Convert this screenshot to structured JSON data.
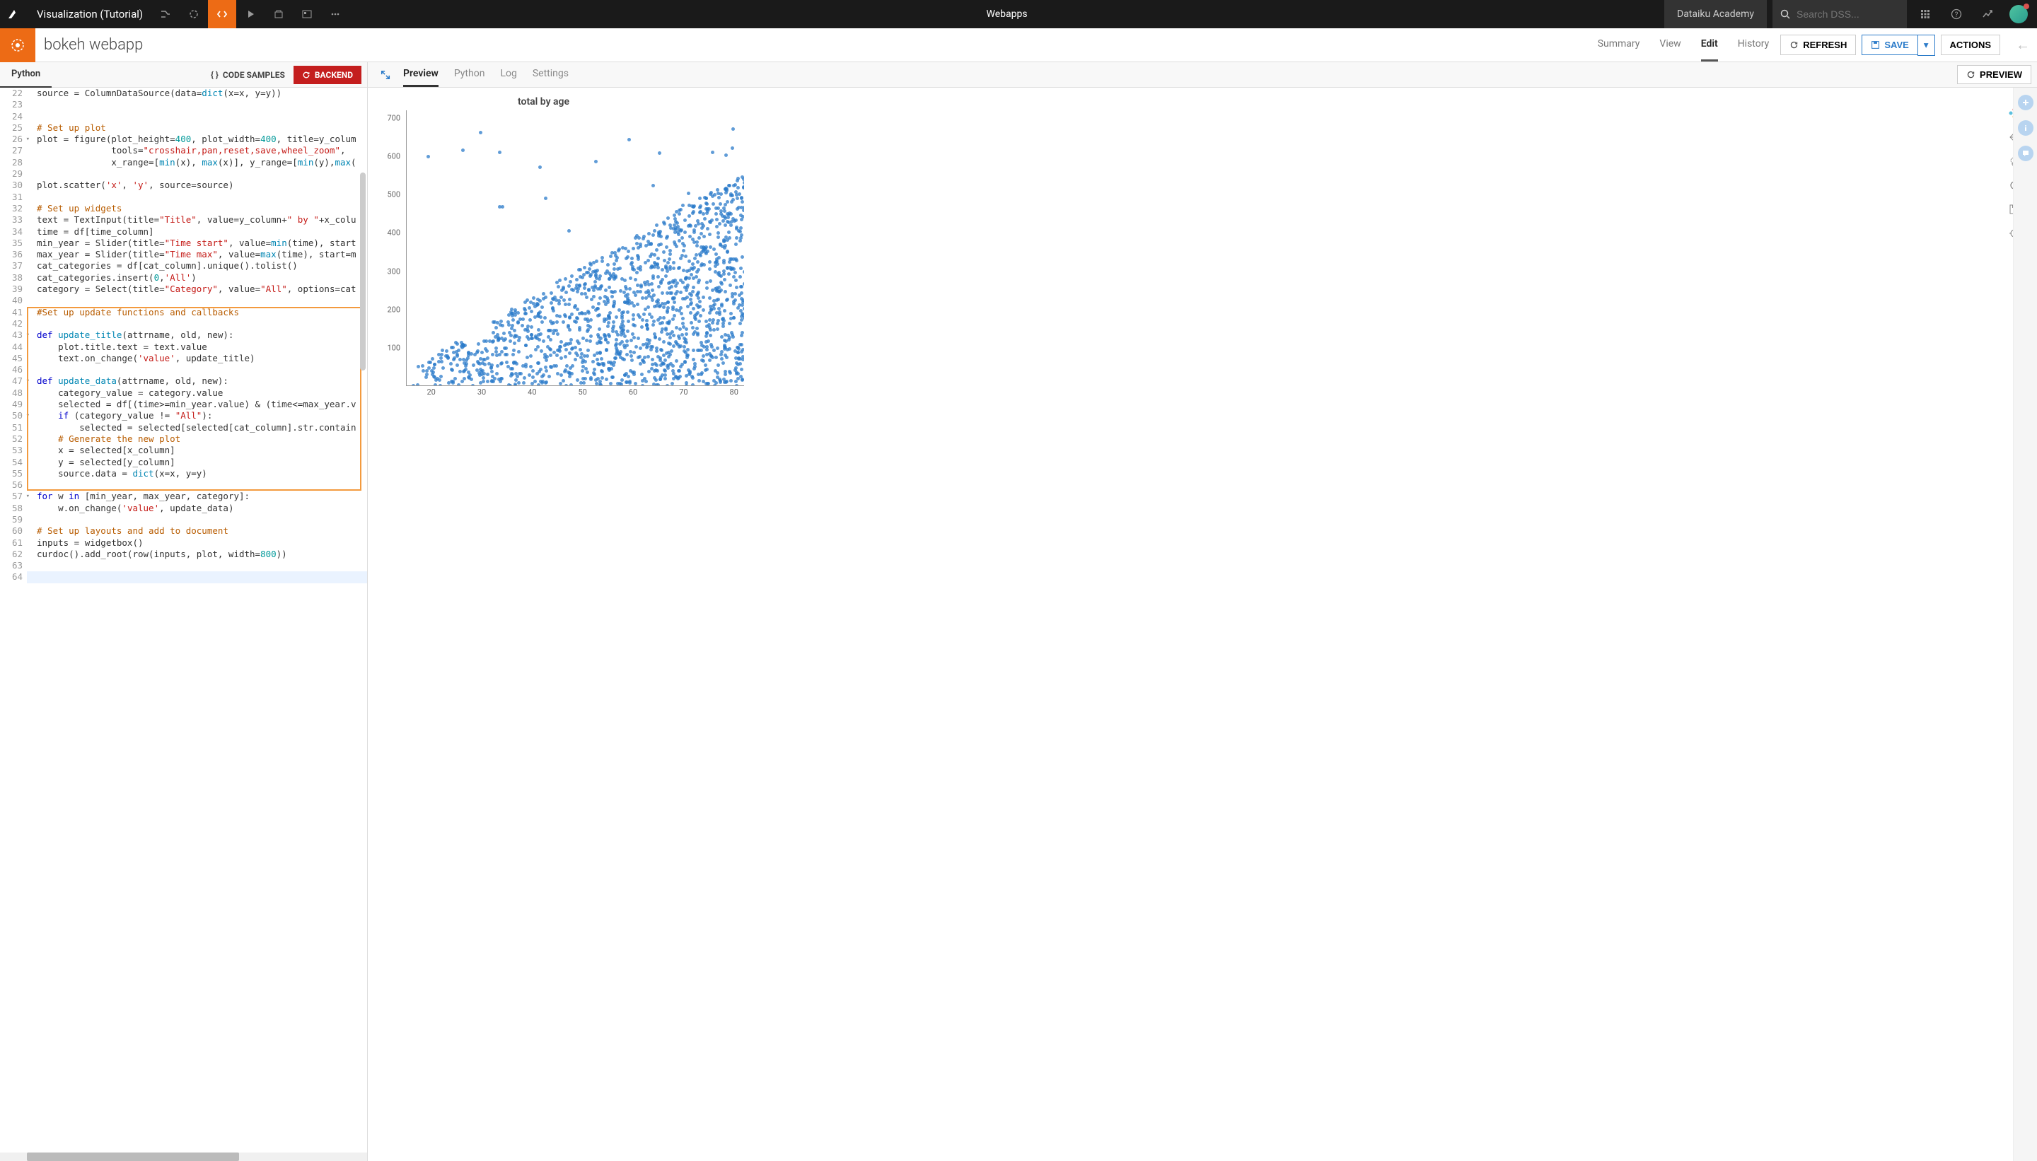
{
  "topbar": {
    "project_title": "Visualization (Tutorial)",
    "center_label": "Webapps",
    "academy": "Dataiku Academy",
    "search_placeholder": "Search DSS..."
  },
  "secondbar": {
    "title": "bokeh webapp",
    "tabs": [
      "Summary",
      "View",
      "Edit",
      "History"
    ],
    "active_tab": 2,
    "refresh": "REFRESH",
    "save": "SAVE",
    "actions": "ACTIONS"
  },
  "thirdbar": {
    "left_tab": "Python",
    "code_samples": "CODE SAMPLES",
    "backend": "BACKEND",
    "preview_tabs": [
      "Preview",
      "Python",
      "Log",
      "Settings"
    ],
    "preview_active": 0,
    "preview_btn": "PREVIEW"
  },
  "editor": {
    "start_line": 22,
    "fold_lines": [
      26,
      43,
      47,
      50,
      57
    ],
    "highlight_start": 41,
    "highlight_end": 56,
    "current_line": 64,
    "lines": [
      [
        [
          "va",
          "source = ColumnDataSource(data="
        ],
        [
          "fn",
          "dict"
        ],
        [
          "va",
          "(x=x, y=y))"
        ]
      ],
      [],
      [],
      [
        [
          "cm",
          "# Set up plot"
        ]
      ],
      [
        [
          "va",
          "plot = figure(plot_height="
        ],
        [
          "nm",
          "400"
        ],
        [
          "va",
          ", plot_width="
        ],
        [
          "nm",
          "400"
        ],
        [
          "va",
          ", title=y_colum"
        ]
      ],
      [
        [
          "va",
          "              tools="
        ],
        [
          "st",
          "\"crosshair,pan,reset,save,wheel_zoom\""
        ],
        [
          "va",
          ","
        ]
      ],
      [
        [
          "va",
          "              x_range=["
        ],
        [
          "fn",
          "min"
        ],
        [
          "va",
          "(x), "
        ],
        [
          "fn",
          "max"
        ],
        [
          "va",
          "(x)], y_range=["
        ],
        [
          "fn",
          "min"
        ],
        [
          "va",
          "(y),"
        ],
        [
          "fn",
          "max"
        ],
        [
          "va",
          "("
        ]
      ],
      [],
      [
        [
          "va",
          "plot.scatter("
        ],
        [
          "st",
          "'x'"
        ],
        [
          "va",
          ", "
        ],
        [
          "st",
          "'y'"
        ],
        [
          "va",
          ", source=source)"
        ]
      ],
      [],
      [
        [
          "cm",
          "# Set up widgets"
        ]
      ],
      [
        [
          "va",
          "text = TextInput(title="
        ],
        [
          "st",
          "\"Title\""
        ],
        [
          "va",
          ", value=y_column+"
        ],
        [
          "st",
          "\" by \""
        ],
        [
          "va",
          "+x_colu"
        ]
      ],
      [
        [
          "va",
          "time = df[time_column]"
        ]
      ],
      [
        [
          "va",
          "min_year = Slider(title="
        ],
        [
          "st",
          "\"Time start\""
        ],
        [
          "va",
          ", value="
        ],
        [
          "fn",
          "min"
        ],
        [
          "va",
          "(time), start"
        ]
      ],
      [
        [
          "va",
          "max_year = Slider(title="
        ],
        [
          "st",
          "\"Time max\""
        ],
        [
          "va",
          ", value="
        ],
        [
          "fn",
          "max"
        ],
        [
          "va",
          "(time), start=m"
        ]
      ],
      [
        [
          "va",
          "cat_categories = df[cat_column].unique().tolist()"
        ]
      ],
      [
        [
          "va",
          "cat_categories.insert("
        ],
        [
          "nm",
          "0"
        ],
        [
          "va",
          ","
        ],
        [
          "st",
          "'All'"
        ],
        [
          "va",
          ")"
        ]
      ],
      [
        [
          "va",
          "category = Select(title="
        ],
        [
          "st",
          "\"Category\""
        ],
        [
          "va",
          ", value="
        ],
        [
          "st",
          "\"All\""
        ],
        [
          "va",
          ", options=cat"
        ]
      ],
      [],
      [
        [
          "cm",
          "#Set up update functions and callbacks"
        ]
      ],
      [],
      [
        [
          "kw",
          "def "
        ],
        [
          "fn",
          "update_title"
        ],
        [
          "va",
          "(attrname, old, new):"
        ]
      ],
      [
        [
          "va",
          "    plot.title.text = text.value"
        ]
      ],
      [
        [
          "va",
          "    text.on_change("
        ],
        [
          "st",
          "'value'"
        ],
        [
          "va",
          ", update_title)"
        ]
      ],
      [],
      [
        [
          "kw",
          "def "
        ],
        [
          "fn",
          "update_data"
        ],
        [
          "va",
          "(attrname, old, new):"
        ]
      ],
      [
        [
          "va",
          "    category_value = category.value"
        ]
      ],
      [
        [
          "va",
          "    selected = df[(time>=min_year.value) & (time<=max_year.v"
        ]
      ],
      [
        [
          "va",
          "    "
        ],
        [
          "kw",
          "if"
        ],
        [
          "va",
          " (category_value != "
        ],
        [
          "st",
          "\"All\""
        ],
        [
          "va",
          "):"
        ]
      ],
      [
        [
          "va",
          "        selected = selected[selected[cat_column].str.contain"
        ]
      ],
      [
        [
          "va",
          "    "
        ],
        [
          "cm",
          "# Generate the new plot"
        ]
      ],
      [
        [
          "va",
          "    x = selected[x_column]"
        ]
      ],
      [
        [
          "va",
          "    y = selected[y_column]"
        ]
      ],
      [
        [
          "va",
          "    source.data = "
        ],
        [
          "fn",
          "dict"
        ],
        [
          "va",
          "(x=x, y=y)"
        ]
      ],
      [],
      [
        [
          "kw",
          "for"
        ],
        [
          "va",
          " w "
        ],
        [
          "kw",
          "in"
        ],
        [
          "va",
          " [min_year, max_year, category]:"
        ]
      ],
      [
        [
          "va",
          "    w.on_change("
        ],
        [
          "st",
          "'value'"
        ],
        [
          "va",
          ", update_data)"
        ]
      ],
      [],
      [
        [
          "cm",
          "# Set up layouts and add to document"
        ]
      ],
      [
        [
          "va",
          "inputs = widgetbox()"
        ]
      ],
      [
        [
          "va",
          "curdoc().add_root(row(inputs, plot, width="
        ],
        [
          "nm",
          "800"
        ],
        [
          "va",
          "))"
        ]
      ],
      [],
      []
    ]
  },
  "chart_data": {
    "type": "scatter",
    "title": "total by age",
    "xlabel": "",
    "ylabel": "",
    "xlim": [
      15,
      82
    ],
    "ylim": [
      0,
      720
    ],
    "xticks": [
      20,
      30,
      40,
      50,
      60,
      70,
      80
    ],
    "yticks": [
      100,
      200,
      300,
      400,
      500,
      600,
      700
    ],
    "note": "Dense scatter of ~1500 points. Density increases along x; wide vertical band 0-550 for x>35; sparse for x<30 concentrated at low y."
  }
}
